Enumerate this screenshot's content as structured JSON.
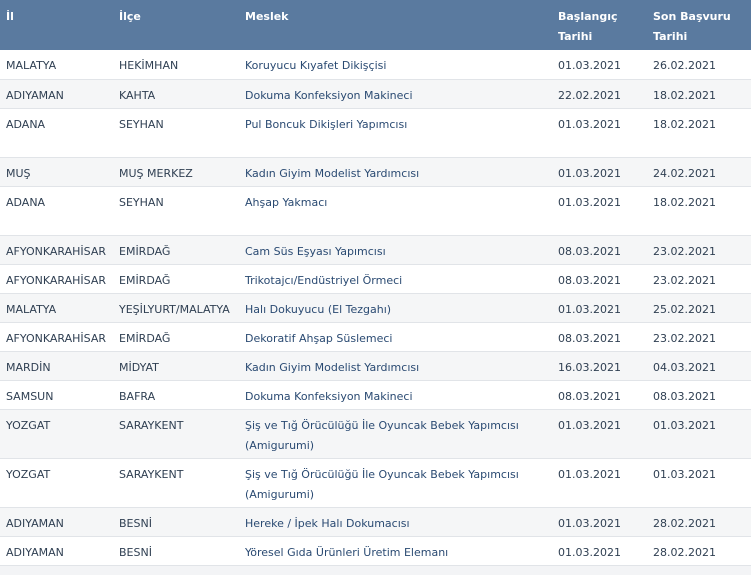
{
  "headers": {
    "il": "İl",
    "ilce": "İlçe",
    "meslek": "Meslek",
    "baslangic": "Başlangıç Tarihi",
    "son_basvuru": "Son Başvuru Tarihi"
  },
  "rows": [
    {
      "il": "MALATYA",
      "ilce": "HEKİMHAN",
      "meslek": "Koruyucu Kıyafet Dikişçisi",
      "baslangic": "01.03.2021",
      "son": "26.02.2021"
    },
    {
      "il": "ADIYAMAN",
      "ilce": "KAHTA",
      "meslek": "Dokuma Konfeksiyon Makineci",
      "baslangic": "22.02.2021",
      "son": "18.02.2021"
    },
    {
      "il": "ADANA",
      "ilce": "SEYHAN",
      "meslek": "Pul Boncuk Dikişleri Yapımcısı",
      "baslangic": "01.03.2021",
      "son": "18.02.2021"
    },
    {
      "il": "MUŞ",
      "ilce": "MUŞ MERKEZ",
      "meslek": "Kadın Giyim Modelist Yardımcısı",
      "baslangic": "01.03.2021",
      "son": "24.02.2021"
    },
    {
      "il": "ADANA",
      "ilce": "SEYHAN",
      "meslek": "Ahşap Yakmacı",
      "baslangic": "01.03.2021",
      "son": "18.02.2021"
    },
    {
      "il": "AFYONKARAHİSAR",
      "ilce": "EMİRDAĞ",
      "meslek": "Cam Süs Eşyası Yapımcısı",
      "baslangic": "08.03.2021",
      "son": "23.02.2021"
    },
    {
      "il": "AFYONKARAHİSAR",
      "ilce": "EMİRDAĞ",
      "meslek": "Trikotajcı/Endüstriyel Örmeci",
      "baslangic": "08.03.2021",
      "son": "23.02.2021"
    },
    {
      "il": "MALATYA",
      "ilce": "YEŞİLYURT/MALATYA",
      "meslek": "Halı Dokuyucu (El Tezgahı)",
      "baslangic": "01.03.2021",
      "son": "25.02.2021"
    },
    {
      "il": "AFYONKARAHİSAR",
      "ilce": "EMİRDAĞ",
      "meslek": "Dekoratif Ahşap Süslemeci",
      "baslangic": "08.03.2021",
      "son": "23.02.2021"
    },
    {
      "il": "MARDİN",
      "ilce": "MİDYAT",
      "meslek": "Kadın Giyim Modelist Yardımcısı",
      "baslangic": "16.03.2021",
      "son": "04.03.2021"
    },
    {
      "il": "SAMSUN",
      "ilce": "BAFRA",
      "meslek": "Dokuma Konfeksiyon Makineci",
      "baslangic": "08.03.2021",
      "son": "08.03.2021"
    },
    {
      "il": "YOZGAT",
      "ilce": "SARAYKENT",
      "meslek": "Şiş ve Tığ Örücülüğü İle Oyuncak Bebek Yapımcısı (Amigurumi)",
      "baslangic": "01.03.2021",
      "son": "01.03.2021"
    },
    {
      "il": "YOZGAT",
      "ilce": "SARAYKENT",
      "meslek": "Şiş ve Tığ Örücülüğü İle Oyuncak Bebek Yapımcısı (Amigurumi)",
      "baslangic": "01.03.2021",
      "son": "01.03.2021"
    },
    {
      "il": "ADIYAMAN",
      "ilce": "BESNİ",
      "meslek": "Hereke / İpek Halı Dokumacısı",
      "baslangic": "01.03.2021",
      "son": "28.02.2021"
    },
    {
      "il": "ADIYAMAN",
      "ilce": "BESNİ",
      "meslek": "Yöresel Gıda Ürünleri Üretim Elemanı",
      "baslangic": "01.03.2021",
      "son": "28.02.2021"
    }
  ]
}
